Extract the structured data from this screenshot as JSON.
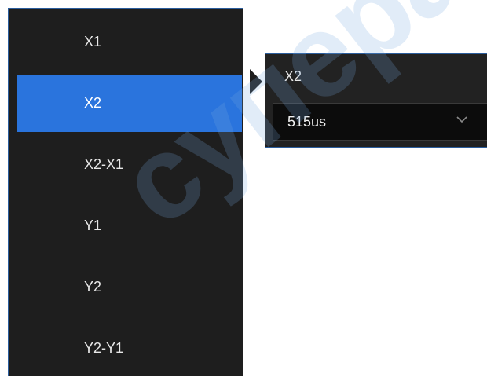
{
  "menu": {
    "items": [
      {
        "label": "X1",
        "selected": false
      },
      {
        "label": "X2",
        "selected": true
      },
      {
        "label": "X2-X1",
        "selected": false
      },
      {
        "label": "Y1",
        "selected": false
      },
      {
        "label": "Y2",
        "selected": false
      },
      {
        "label": "Y2-Y1",
        "selected": false
      }
    ]
  },
  "popover": {
    "title": "X2",
    "value": "515us",
    "dropdown_icon": "chevron-down-icon"
  },
  "watermark": {
    "text": "супераис"
  },
  "colors": {
    "panel_bg": "#1e1e1e",
    "accent": "#2a74dd",
    "border": "#2b5d9c",
    "field_bg": "#0c0c0c",
    "text": "#e8e8e8"
  }
}
